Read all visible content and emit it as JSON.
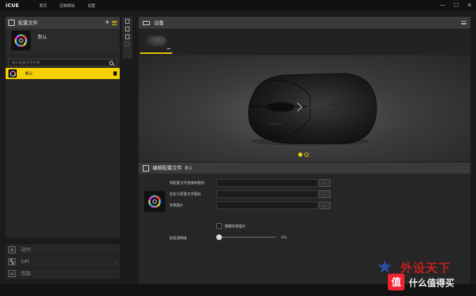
{
  "app": {
    "logo": "iCUE"
  },
  "nav": {
    "items": [
      "首页",
      "控制面板",
      "设置"
    ]
  },
  "window": {
    "minimize": "—",
    "maximize": "☐",
    "close": "✕"
  },
  "profiles": {
    "title": "配置文件",
    "add_label": "+",
    "current_name": "默认",
    "search_placeholder": "输入配置文件名称",
    "list": [
      {
        "name": "默认",
        "selected": true
      }
    ]
  },
  "left_bottom": {
    "items": [
      {
        "label": "动作",
        "icon": "A"
      },
      {
        "label": "DPI",
        "icon": "▚"
      },
      {
        "label": "性能",
        "icon": "≡"
      }
    ],
    "dpi_arrow": "›"
  },
  "devices": {
    "title": "设备"
  },
  "carousel": {
    "pages": 2,
    "active_index": 0
  },
  "editor": {
    "title": "编辑配置文件",
    "profile_name": "默认",
    "link_label": "将配置文件连接到程序",
    "icon_label": "自定义配置文件图标",
    "bg_label": "背景图片",
    "blur_label": "模糊背景图片",
    "opacity_label": "标签透明度",
    "opacity_value": "0%",
    "opacity_level": 0,
    "browse": "..."
  },
  "watermark": {
    "line1": "外设天下",
    "line2": "什么值得买",
    "badge": "值"
  },
  "colors": {
    "accent": "#f5d000",
    "panel": "#262626",
    "header": "#3a3a3a"
  }
}
